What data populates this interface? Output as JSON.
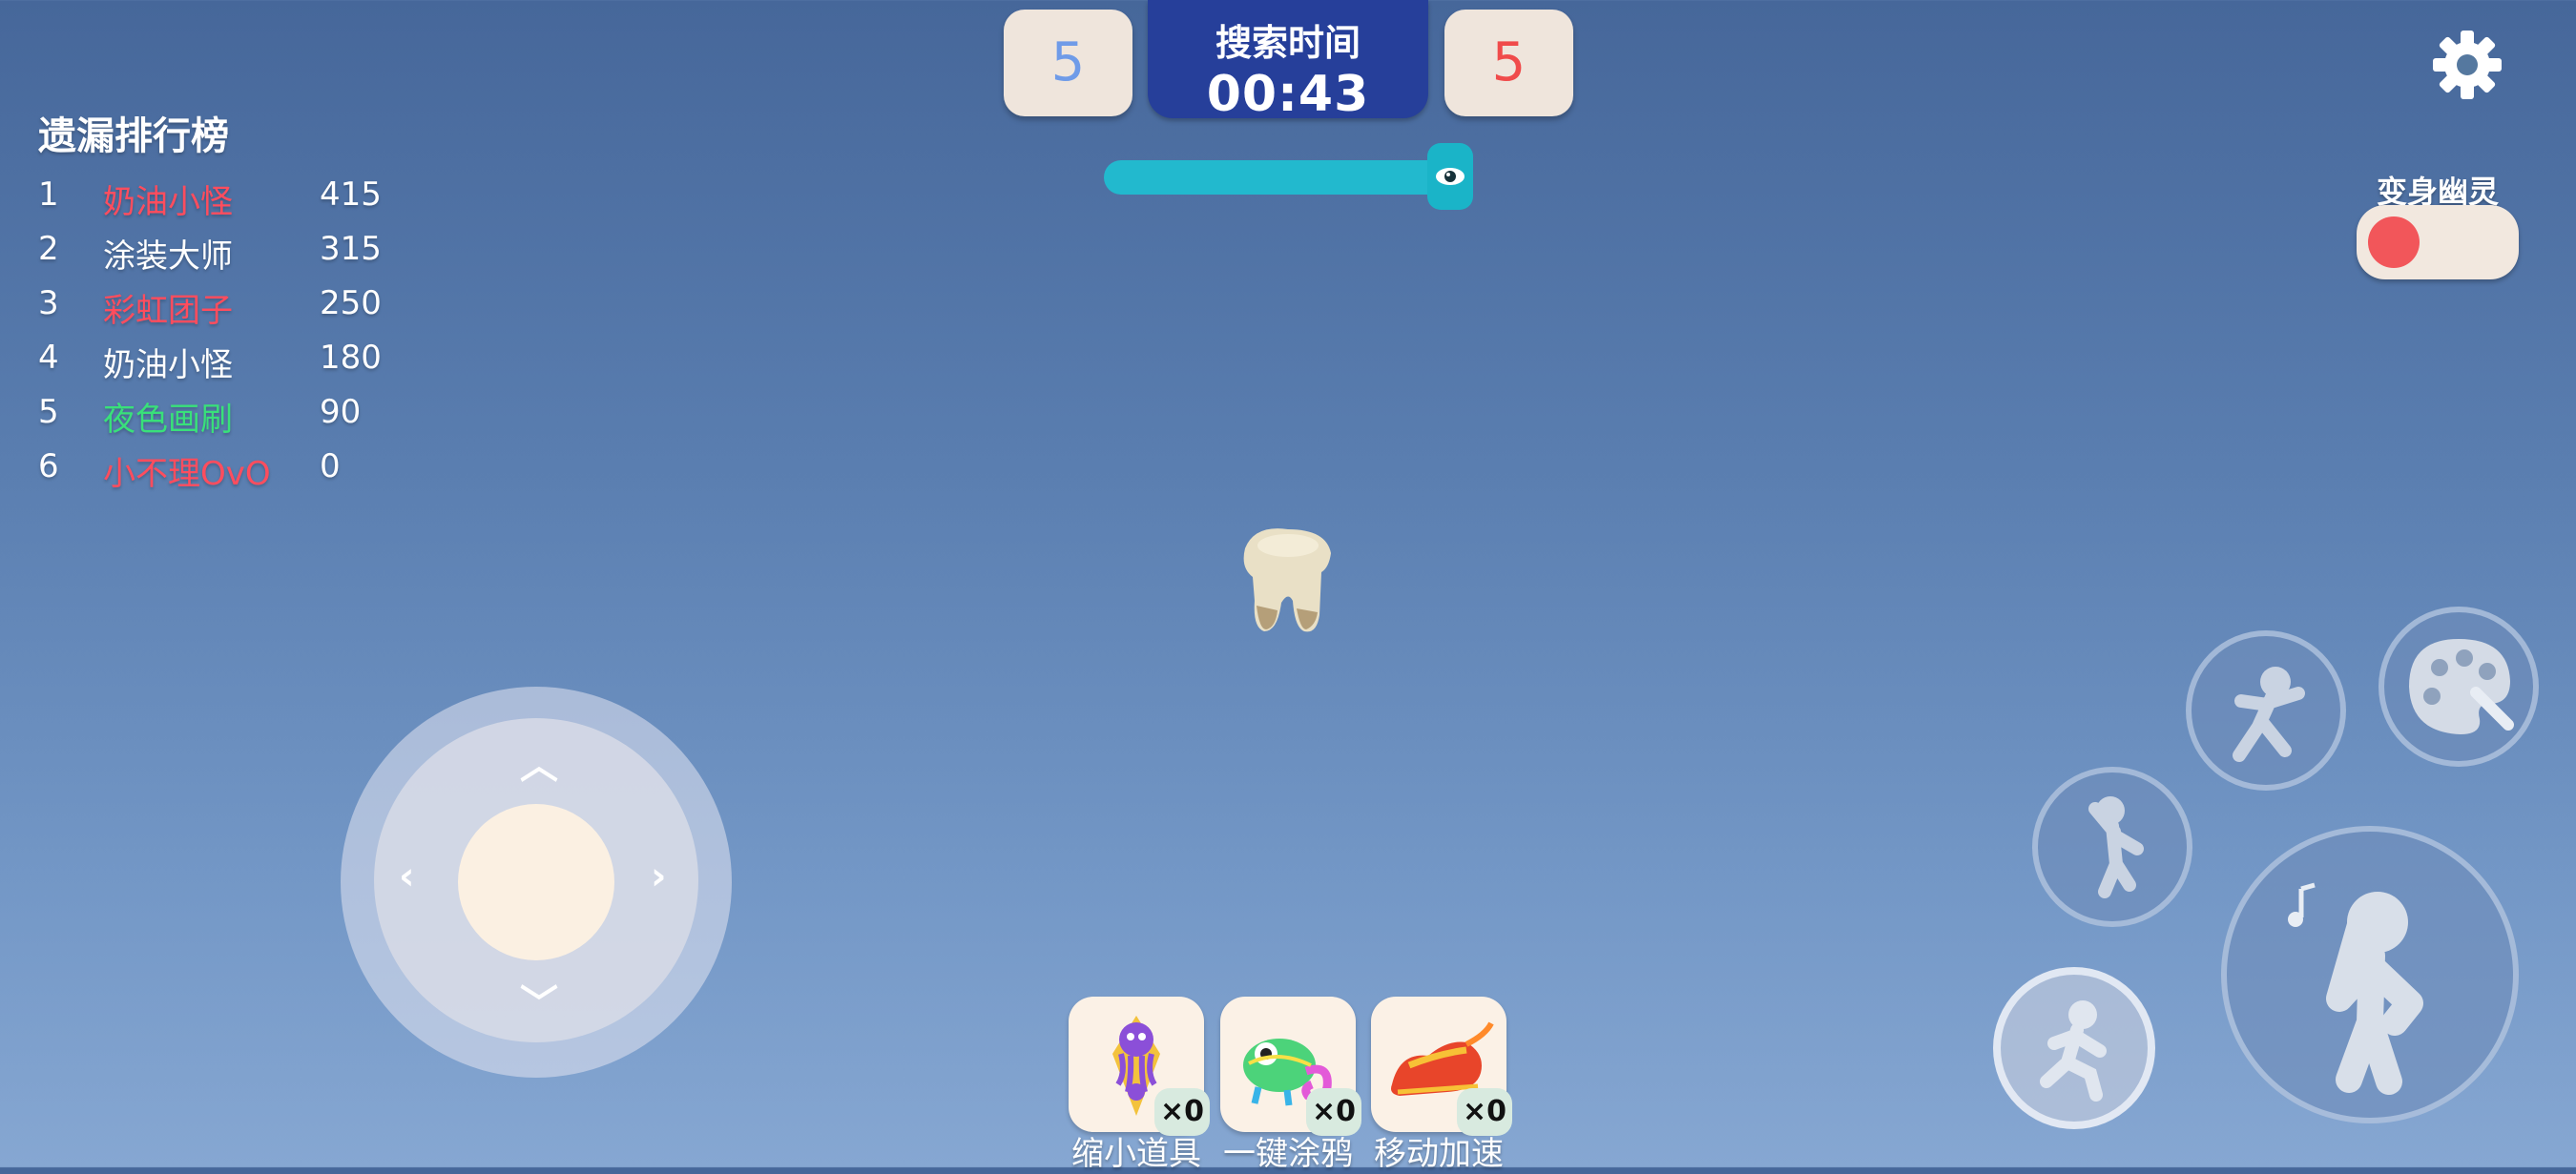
{
  "leaderboard": {
    "title": "遗漏排行榜",
    "entries": [
      {
        "rank": "1",
        "name": "奶油小怪",
        "score": "415",
        "color": "#ff4d5e"
      },
      {
        "rank": "2",
        "name": "涂装大师",
        "score": "315",
        "color": "#ffffff"
      },
      {
        "rank": "3",
        "name": "彩虹团子",
        "score": "250",
        "color": "#ff4d5e"
      },
      {
        "rank": "4",
        "name": "奶油小怪",
        "score": "180",
        "color": "#ffffff"
      },
      {
        "rank": "5",
        "name": "夜色画刷",
        "score": "90",
        "color": "#39e07a"
      },
      {
        "rank": "6",
        "name": "小不理OvO",
        "score": "0",
        "color": "#ff4d5e"
      }
    ]
  },
  "top": {
    "left_score": "5",
    "left_color": "#6f9be8",
    "right_score": "5",
    "right_color": "#f04b4b",
    "timer_label": "搜索时间",
    "timer_value": "00:43",
    "progress_fraction": 1.0
  },
  "ghost_toggle": {
    "label": "变身幽灵",
    "on": false
  },
  "items": [
    {
      "label": "缩小道具",
      "count": "×0",
      "icon": "purple-octopus-icon"
    },
    {
      "label": "一键涂鸦",
      "count": "×0",
      "icon": "chameleon-icon"
    },
    {
      "label": "移动加速",
      "count": "×0",
      "icon": "speed-shoe-icon"
    }
  ],
  "icons": {
    "settings": "gear-icon",
    "actions": [
      "dance-icon",
      "paint-palette-icon",
      "jump-icon",
      "emote-icon",
      "run-icon"
    ]
  }
}
